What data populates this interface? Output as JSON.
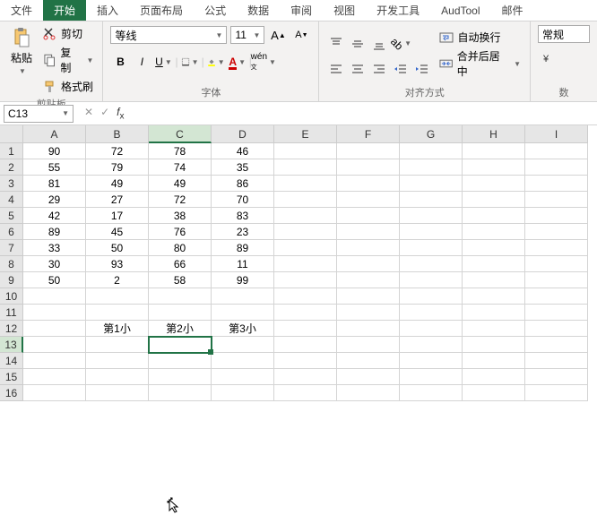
{
  "tabs": [
    "文件",
    "开始",
    "插入",
    "页面布局",
    "公式",
    "数据",
    "审阅",
    "视图",
    "开发工具",
    "AudTool",
    "邮件"
  ],
  "active_tab_index": 1,
  "ribbon": {
    "clipboard": {
      "label": "剪贴板",
      "paste": "粘贴",
      "cut": "剪切",
      "copy": "复制",
      "format_painter": "格式刷"
    },
    "font": {
      "label": "字体",
      "name": "等线",
      "size": "11"
    },
    "align": {
      "label": "对齐方式",
      "wrap": "自动换行",
      "merge": "合并后居中"
    },
    "number": {
      "label": "数",
      "format": "常规"
    }
  },
  "namebox": "C13",
  "columns": [
    "A",
    "B",
    "C",
    "D",
    "E",
    "F",
    "G",
    "H",
    "I"
  ],
  "rows": [
    {
      "n": 1,
      "cells": [
        "90",
        "72",
        "78",
        "46",
        "",
        "",
        "",
        "",
        ""
      ]
    },
    {
      "n": 2,
      "cells": [
        "55",
        "79",
        "74",
        "35",
        "",
        "",
        "",
        "",
        ""
      ]
    },
    {
      "n": 3,
      "cells": [
        "81",
        "49",
        "49",
        "86",
        "",
        "",
        "",
        "",
        ""
      ]
    },
    {
      "n": 4,
      "cells": [
        "29",
        "27",
        "72",
        "70",
        "",
        "",
        "",
        "",
        ""
      ]
    },
    {
      "n": 5,
      "cells": [
        "42",
        "17",
        "38",
        "83",
        "",
        "",
        "",
        "",
        ""
      ]
    },
    {
      "n": 6,
      "cells": [
        "89",
        "45",
        "76",
        "23",
        "",
        "",
        "",
        "",
        ""
      ]
    },
    {
      "n": 7,
      "cells": [
        "33",
        "50",
        "80",
        "89",
        "",
        "",
        "",
        "",
        ""
      ]
    },
    {
      "n": 8,
      "cells": [
        "30",
        "93",
        "66",
        "11",
        "",
        "",
        "",
        "",
        ""
      ]
    },
    {
      "n": 9,
      "cells": [
        "50",
        "2",
        "58",
        "99",
        "",
        "",
        "",
        "",
        ""
      ]
    },
    {
      "n": 10,
      "cells": [
        "",
        "",
        "",
        "",
        "",
        "",
        "",
        "",
        ""
      ]
    },
    {
      "n": 11,
      "cells": [
        "",
        "",
        "",
        "",
        "",
        "",
        "",
        "",
        ""
      ]
    },
    {
      "n": 12,
      "cells": [
        "",
        "第1小",
        "第2小",
        "第3小",
        "",
        "",
        "",
        "",
        ""
      ]
    },
    {
      "n": 13,
      "cells": [
        "",
        "",
        "",
        "",
        "",
        "",
        "",
        "",
        ""
      ]
    },
    {
      "n": 14,
      "cells": [
        "",
        "",
        "",
        "",
        "",
        "",
        "",
        "",
        ""
      ]
    },
    {
      "n": 15,
      "cells": [
        "",
        "",
        "",
        "",
        "",
        "",
        "",
        "",
        ""
      ]
    },
    {
      "n": 16,
      "cells": [
        "",
        "",
        "",
        "",
        "",
        "",
        "",
        "",
        ""
      ]
    }
  ],
  "selected": {
    "row": 13,
    "col": 2
  }
}
